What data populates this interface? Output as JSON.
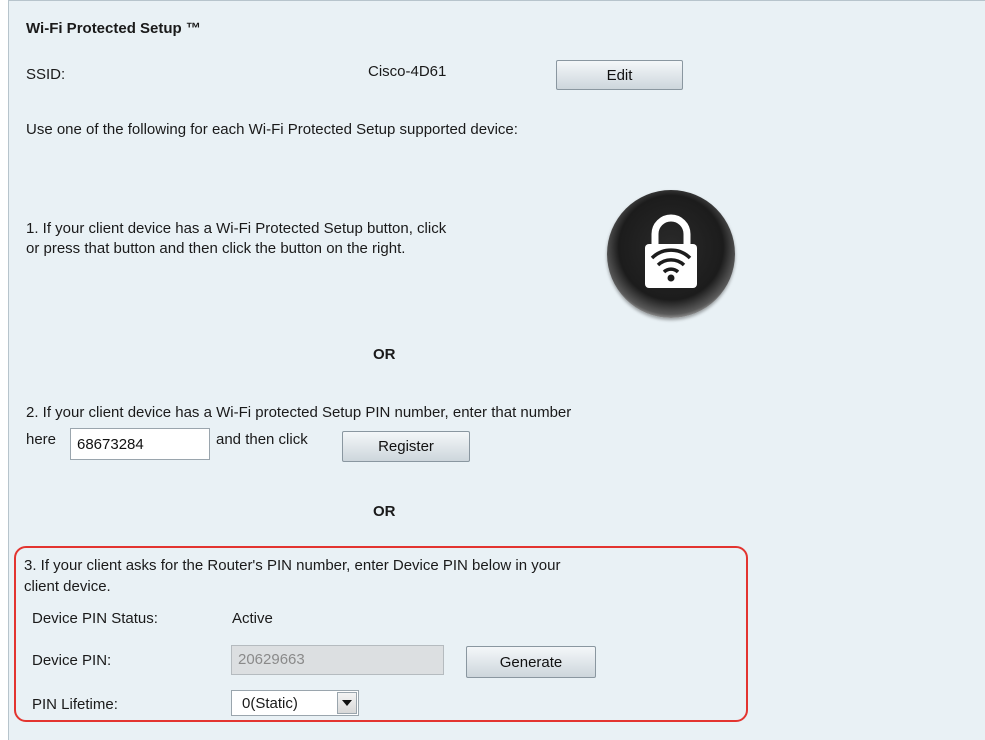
{
  "section": {
    "title": "Wi-Fi Protected Setup ™"
  },
  "ssid": {
    "label": "SSID:",
    "value": "Cisco-4D61",
    "edit_label": "Edit"
  },
  "intro": "Use one of the following for each Wi-Fi Protected Setup supported device:",
  "option1": {
    "line1": "1. If your client device has a Wi-Fi Protected Setup button, click",
    "line2": "or press that button and then click the button on the right.",
    "icon": "wps-lock-wifi-icon"
  },
  "or_label": "OR",
  "option2": {
    "line1": "2. If your client device has a Wi-Fi protected Setup PIN number, enter that number",
    "here": "here",
    "pin_value": "68673284",
    "then_click": "and then click",
    "register_label": "Register"
  },
  "option3": {
    "line1": "3. If your client asks for the Router's PIN number, enter Device PIN below in your",
    "line2": "client device.",
    "status_label": "Device PIN Status:",
    "status_value": "Active",
    "pin_label": "Device PIN:",
    "pin_value": "20629663",
    "generate_label": "Generate",
    "lifetime_label": "PIN Lifetime:",
    "lifetime_value": "0(Static)"
  },
  "colors": {
    "panel_bg": "#e9f1f5",
    "highlight_border": "#e3342f"
  }
}
